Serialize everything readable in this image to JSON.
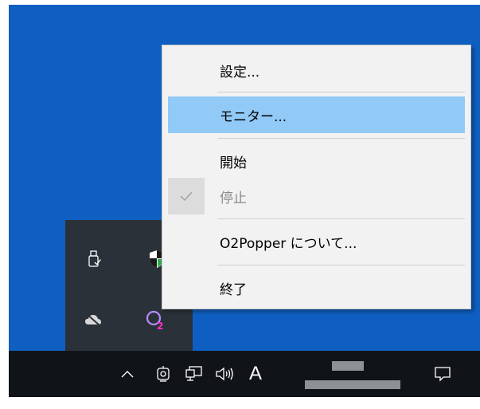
{
  "menu": {
    "items": [
      {
        "label": "設定..."
      },
      {
        "label": "モニター..."
      },
      {
        "label": "開始"
      },
      {
        "label": "停止"
      },
      {
        "label": "O2Popper について..."
      },
      {
        "label": "終了"
      }
    ]
  },
  "tray": {
    "icons": [
      "usb-drive-icon",
      "security-shield-icon",
      "cloud-offline-icon",
      "o2popper-icon"
    ]
  },
  "taskbar": {
    "ime_label": "A",
    "icons": [
      "chevron-up-icon",
      "meet-now-icon",
      "network-icon",
      "volume-icon",
      "notification-icon"
    ]
  },
  "colors": {
    "desktop": "#0f5fc2",
    "taskbar": "#101418",
    "tray_flyout": "#2b3138",
    "menu_bg": "#f2f2f2",
    "menu_highlight": "#91c9f7",
    "o2popper_accent": "#ff2fd0"
  }
}
